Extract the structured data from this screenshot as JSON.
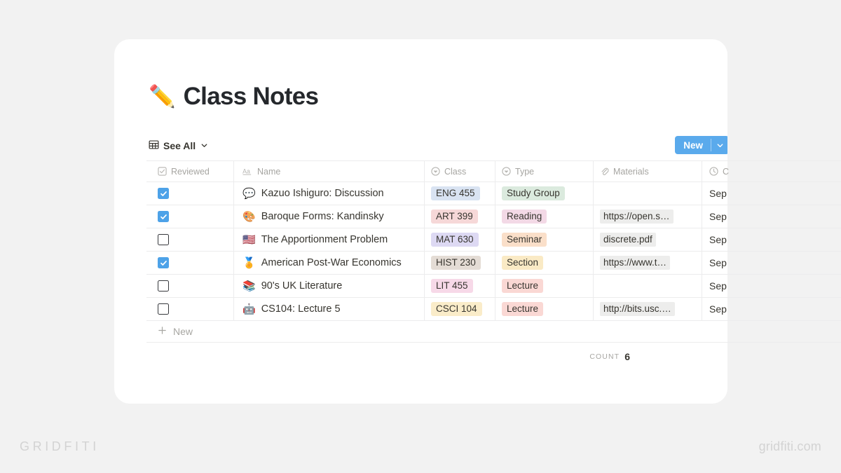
{
  "page": {
    "title_emoji": "✏️",
    "title": "Class Notes"
  },
  "toolbar": {
    "view_icon": "table-grid-icon",
    "view_label": "See All",
    "view_chevron_icon": "chevron-down-icon",
    "new_label": "New",
    "new_chevron_icon": "chevron-down-icon",
    "new_button_color": "#5aaaec"
  },
  "table": {
    "columns": [
      {
        "key": "reviewed",
        "label": "Reviewed",
        "icon": "checkbox-icon"
      },
      {
        "key": "name",
        "label": "Name",
        "icon": "text-aa-icon"
      },
      {
        "key": "class",
        "label": "Class",
        "icon": "select-icon"
      },
      {
        "key": "type",
        "label": "Type",
        "icon": "select-icon"
      },
      {
        "key": "materials",
        "label": "Materials",
        "icon": "paperclip-icon"
      },
      {
        "key": "date",
        "label": "C",
        "icon": "clock-icon"
      }
    ],
    "rows": [
      {
        "reviewed": true,
        "emoji": "💬",
        "name": "Kazuo Ishiguro: Discussion",
        "class": "ENG 455",
        "class_color": "#d9e3f2",
        "type": "Study Group",
        "type_color": "#dbeade",
        "materials": "",
        "date": "Sep"
      },
      {
        "reviewed": true,
        "emoji": "🎨",
        "name": "Baroque Forms: Kandinsky",
        "class": "ART 399",
        "class_color": "#f6d8d8",
        "type": "Reading",
        "type_color": "#f3d9e6",
        "materials": "https://open.s…",
        "date": "Sep"
      },
      {
        "reviewed": false,
        "emoji": "🇺🇸",
        "name": "The Apportionment Problem",
        "class": "MAT 630",
        "class_color": "#ddd9f3",
        "type": "Seminar",
        "type_color": "#fadfc9",
        "materials": "discrete.pdf",
        "date": "Sep"
      },
      {
        "reviewed": true,
        "emoji": "🏅",
        "name": "American Post-War Economics",
        "class": "HIST 230",
        "class_color": "#e4dcd5",
        "type": "Section",
        "type_color": "#faeac5",
        "materials": "https://www.t…",
        "date": "Sep"
      },
      {
        "reviewed": false,
        "emoji": "📚",
        "name": "90's UK Literature",
        "class": "LIT 455",
        "class_color": "#f7d9e8",
        "type": "Lecture",
        "type_color": "#fad8d4",
        "materials": "",
        "date": "Sep"
      },
      {
        "reviewed": false,
        "emoji": "🤖",
        "name": "CS104: Lecture 5",
        "class": "CSCI 104",
        "class_color": "#faecc9",
        "type": "Lecture",
        "type_color": "#fad8d4",
        "materials": "http://bits.usc.…",
        "date": "Sep"
      }
    ],
    "new_row_label": "New",
    "new_row_icon": "plus-icon",
    "count_label": "Count",
    "count_value": "6"
  },
  "watermarks": {
    "left": "GRIDFITI",
    "right": "gridfiti.com"
  }
}
